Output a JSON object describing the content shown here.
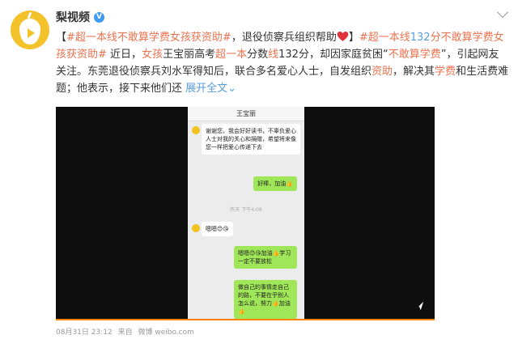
{
  "account": {
    "username": "梨视频",
    "verified_mark": "V"
  },
  "post": {
    "p1": "【",
    "tag1": "#超一本线不敢算学费女孩获资助#",
    "p2": "，退役侦察兵组织帮助",
    "p3": "】",
    "tag2a": "#超一本线",
    "tag2b": "132",
    "tag2c": "分不敢算学费女孩获资助#",
    "p4": " 近日，",
    "l1": "女孩",
    "p5": "王宝丽高考",
    "l2": "超一本",
    "p6": "分数",
    "l3": "线",
    "p7": "132分，却因家庭贫困“",
    "l4": "不敢算学费",
    "p8": "”，引起网友关注。东莞退役侦察兵刘水军得知后，联合多名爱心人士，自发组织",
    "l5": "资助",
    "p9": "，解决其",
    "l6": "学费",
    "p10": "和生活费难题；他表示，接下来他们还 ",
    "more": "展开全文",
    "more_arrow": "⌄"
  },
  "video": {
    "contact": "王宝丽",
    "msg1": "谢谢您，我会好好读书，不辜负爱心人士对我的关心和捐赠，希望将来像您一样把爱心传递下去",
    "msg2": "好棒，加油👍",
    "timestamp": "昨天 下午4:08",
    "msg3": "嗯嗯😊😘",
    "msg4": "嗯嗯😊😘加油👍学习一定不要放松",
    "msg5": "做自己的事情走自己的路，不要在乎别人怎么说，努力👍加油👍"
  },
  "footer": {
    "date": "08月31日 23:12",
    "source_label": "来自",
    "source": "微博 weibo.com"
  },
  "colors": {
    "brand": "#f4c22b",
    "tag": "#eb7350",
    "link": "#5a9dd8",
    "progress": "#ff8200",
    "bubble_out": "#9fe658"
  }
}
